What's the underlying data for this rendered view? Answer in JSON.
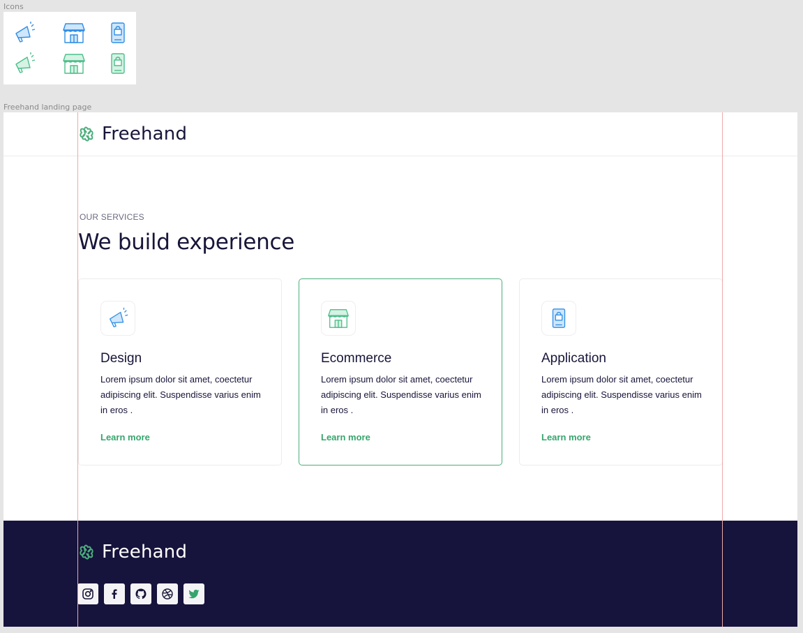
{
  "frames": {
    "icons_label": "Icons",
    "page_label": "Freehand landing page"
  },
  "icon_set": {
    "row_blue": [
      "megaphone-icon",
      "storefront-icon",
      "phone-bag-icon"
    ],
    "row_green": [
      "megaphone-icon",
      "storefront-icon",
      "phone-bag-icon"
    ]
  },
  "header": {
    "brand": "Freehand"
  },
  "services": {
    "eyebrow": "OUR SERVICES",
    "title": "We build experience",
    "cards": [
      {
        "icon": "megaphone-icon",
        "title": "Design",
        "desc": "Lorem ipsum dolor sit amet, coectetur adipiscing elit. Suspendisse varius enim in eros .",
        "link": "Learn more",
        "active": false
      },
      {
        "icon": "storefront-icon",
        "title": "Ecommerce",
        "desc": "Lorem ipsum dolor sit amet, coectetur adipiscing elit. Suspendisse varius enim in eros .",
        "link": "Learn more",
        "active": true
      },
      {
        "icon": "phone-bag-icon",
        "title": "Application",
        "desc": "Lorem ipsum dolor sit amet, coectetur adipiscing elit. Suspendisse varius enim in eros .",
        "link": "Learn more",
        "active": false
      }
    ]
  },
  "footer": {
    "brand": "Freehand",
    "socials": [
      "instagram-icon",
      "facebook-icon",
      "github-icon",
      "dribbble-icon",
      "twitter-icon"
    ]
  },
  "colors": {
    "navy": "#171539",
    "footer_bg": "#16133c",
    "accent_green": "#36a56d",
    "icon_blue": "#2f8ee6",
    "icon_green": "#4cbf8a"
  }
}
